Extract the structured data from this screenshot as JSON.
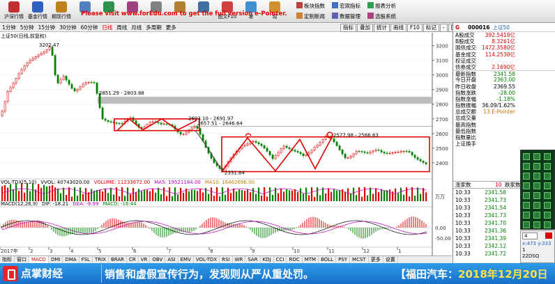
{
  "toolbar": {
    "buttons": [
      {
        "label": "沪深行情",
        "icon": "market-icon",
        "color": "#c03030"
      },
      {
        "label": "基金行情",
        "icon": "fund-icon",
        "color": "#3060c0"
      },
      {
        "label": "期现行情",
        "icon": "futures-icon",
        "color": "#c08020"
      },
      {
        "label": "",
        "icon": "grid-icon",
        "color": "#5080c0"
      },
      {
        "label": "",
        "icon": "chart-icon",
        "color": "#309050"
      },
      {
        "label": "",
        "icon": "bell-icon",
        "color": "#a04080"
      },
      {
        "label": "",
        "icon": "doc-icon",
        "color": "#808080"
      },
      {
        "label": "",
        "icon": "tool-icon",
        "color": "#b08030"
      },
      {
        "label": "",
        "icon": "person-icon",
        "color": "#4070a0"
      },
      {
        "label": "图文F10",
        "icon": "f10-icon",
        "color": "#d04040"
      },
      {
        "label": "发",
        "icon": "send-icon",
        "color": "#4090d0"
      },
      {
        "label": "现",
        "icon": "find-icon",
        "color": "#d09030"
      }
    ],
    "banner": "Please visit www.forEdu.com to get the full version e-Pointer.",
    "menu": [
      "板块指数",
      "宏观指标",
      "报表分析",
      "定制新闻",
      "数据管理",
      "选股系统"
    ]
  },
  "timeframes": [
    "1分钟",
    "5分钟",
    "15分钟",
    "30分钟",
    "60分钟",
    "日线",
    "周线",
    "月线",
    "多周期",
    "更多"
  ],
  "active_timeframe": "日线",
  "operations": [
    "指标",
    "叠加",
    "统计",
    "画线",
    "F10",
    "标记",
    "-",
    "回首"
  ],
  "chart": {
    "title": "上证50(日线,前复权)",
    "y_ticks": [
      "3200",
      "3100",
      "3000",
      "2900",
      "2800",
      "2700",
      "2600",
      "2500",
      "2400"
    ],
    "annotations": [
      "3202.47",
      "2851.29 - 2803.88",
      "2693.10 - 2691.97",
      "2657.51 - 2646.64",
      "2577.98 - 2566.63",
      "2331.84"
    ],
    "x_labels": [
      "2017年",
      "2",
      "3",
      "4",
      "5",
      "6",
      "7",
      "8",
      "9",
      "10",
      "11",
      "12",
      "1"
    ]
  },
  "volume": {
    "header": [
      "VOL-TDX(5,10)",
      "VVOL: 40743020.00",
      "VOLUME: 11233672.00",
      "MA5: 19521184.00",
      "MA10: 16462696.00"
    ],
    "scale": "万万"
  },
  "macd": {
    "header": [
      "MACD(12,26,9)",
      "DIF: -18.21",
      "DEA: -9.99",
      "MACD: -16.44"
    ],
    "scale": [
      "0.00",
      "-50.00"
    ]
  },
  "bottom_tabs": [
    "指标",
    "窗口",
    "MACD",
    "DMI",
    "DMA",
    "FSL",
    "TRIX",
    "BRAR",
    "CR",
    "VR",
    "OBV",
    "ASI",
    "EMV",
    "VOL-TDX",
    "RSI",
    "WR",
    "SAR",
    "KDJ",
    "CCI",
    "ROC",
    "MTM",
    "BOLL",
    "PSY",
    "MCST",
    "更多",
    "设置"
  ],
  "active_tab": "MACD",
  "side_quote": {
    "g": "G",
    "code": "000016",
    "name": "上证50",
    "rows": [
      {
        "k": "A股成交",
        "v": "392.5418亿",
        "c": "red"
      },
      {
        "k": "B股成交",
        "v": "8.3261亿",
        "c": "red"
      },
      {
        "k": "国债成交",
        "v": "1472.3580亿",
        "c": "red"
      },
      {
        "k": "基金成交",
        "v": "114.2538亿",
        "c": "red"
      },
      {
        "k": "权证成交",
        "v": "",
        "c": "blk"
      },
      {
        "k": "债券成交",
        "v": "2.1690亿",
        "c": "red"
      },
      {
        "k": "最新指数",
        "v": "2341.58",
        "c": "grn"
      },
      {
        "k": "今日开盘",
        "v": "2363.00",
        "c": "grn"
      },
      {
        "k": "昨日收盘",
        "v": "2369.55",
        "c": "blk"
      },
      {
        "k": "指数涨跌",
        "v": "-28.00",
        "c": "grn"
      },
      {
        "k": "指数涨幅",
        "v": "-1.18%",
        "c": "grn"
      },
      {
        "k": "指数振幅",
        "v": "36.09/1.62%",
        "c": "blk"
      },
      {
        "k": "总成交额",
        "v": "13 E-Pointer",
        "c": "org"
      },
      {
        "k": "总成交量",
        "v": "",
        "c": "blk"
      },
      {
        "k": "最高指数",
        "v": "",
        "c": "blk"
      },
      {
        "k": "最低指数",
        "v": "",
        "c": "blk"
      },
      {
        "k": "指数量比",
        "v": "",
        "c": "blk"
      },
      {
        "k": "上证换手",
        "v": "",
        "c": "blk"
      }
    ],
    "tick_header": {
      "a": "涨家数",
      "b": "10",
      "c": "跌家数"
    },
    "ticks": [
      {
        "t": "10:33",
        "p": "2341.58"
      },
      {
        "t": "10:33",
        "p": "2341.73"
      },
      {
        "t": "10:33",
        "p": "2341.54"
      },
      {
        "t": "10:33",
        "p": "2341.73"
      },
      {
        "t": "10:33",
        "p": "2341.70"
      },
      {
        "t": "10:33",
        "p": "2341.36"
      },
      {
        "t": "10:33",
        "p": "2341.39"
      },
      {
        "t": "10:33",
        "p": "2342.12"
      },
      {
        "t": "10:33",
        "p": "2341.72"
      }
    ]
  },
  "pen_panel": {
    "size": "4",
    "coords": "x:473  y:333",
    "mode": "1",
    "time": "22DSQ"
  },
  "ticker": {
    "logo": "点掌财经",
    "text1": "销售和虚假宣传行为，发现则从严从重处罚。",
    "text2_prefix": "【福田汽车：",
    "text2_date": "2018年12月20日"
  },
  "colors": {
    "up": "#e00000",
    "down": "#008000",
    "annotation": "#e00000"
  }
}
